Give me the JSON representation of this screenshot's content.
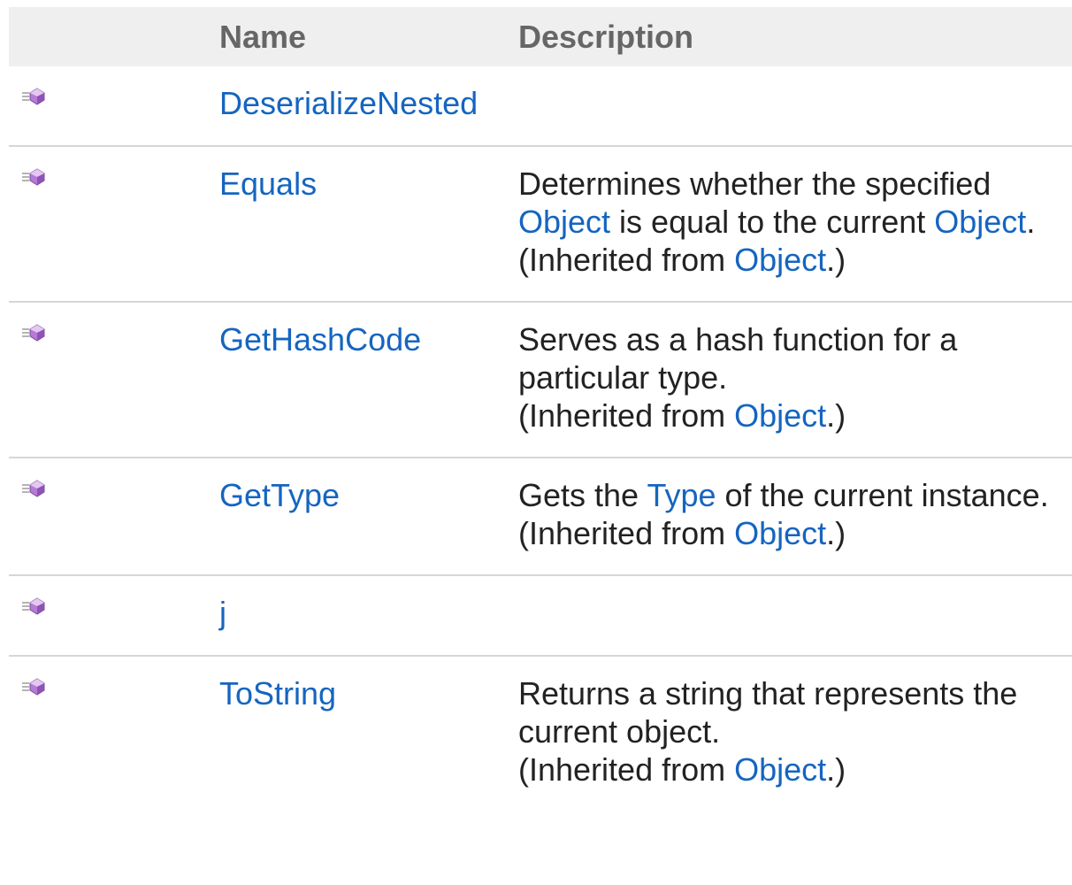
{
  "table": {
    "columns": {
      "name": "Name",
      "description": "Description"
    },
    "icon": "public-method-icon",
    "colors": {
      "link": "#1565c0",
      "header_bg": "#efefef",
      "header_text": "#666666",
      "row_border": "#d6d6d6",
      "icon_body": "#b57bd6"
    },
    "inherited_prefix": "(Inherited from ",
    "inherited_link": "Object",
    "inherited_suffix": ".)",
    "rows": [
      {
        "name": "DeserializeNested"
      },
      {
        "name": "Equals",
        "desc": {
          "p1": "Determines whether the specified ",
          "link1": "Object",
          "p2": " is equal to the current ",
          "link2": "Object",
          "p3": "."
        }
      },
      {
        "name": "GetHashCode",
        "desc": {
          "p1": "Serves as a hash function for a particular type."
        }
      },
      {
        "name": "GetType",
        "desc": {
          "p1": "Gets the ",
          "link1": "Type",
          "p2": " of the current instance."
        }
      },
      {
        "name": "j"
      },
      {
        "name": "ToString",
        "desc": {
          "p1": "Returns a string that represents the current object."
        }
      }
    ]
  }
}
